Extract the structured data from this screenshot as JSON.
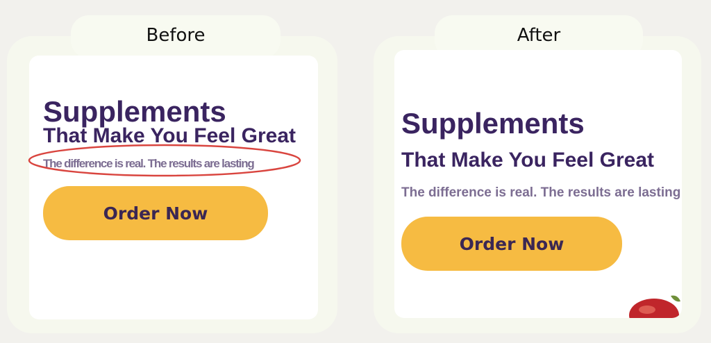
{
  "before": {
    "label": "Before",
    "title_line1": "Supplements",
    "title_line2": "That Make You Feel Great",
    "subtitle": "The difference is real. The results are lasting",
    "button_label": "Order Now"
  },
  "after": {
    "label": "After",
    "title_line1": "Supplements",
    "title_line2": "That Make You Feel Great",
    "subtitle": "The difference is real. The results are lasting",
    "button_label": "Order Now"
  },
  "colors": {
    "title": "#3a2460",
    "subtitle": "#7c6d92",
    "button": "#f6bb42",
    "highlight_ring": "#d9453f"
  }
}
